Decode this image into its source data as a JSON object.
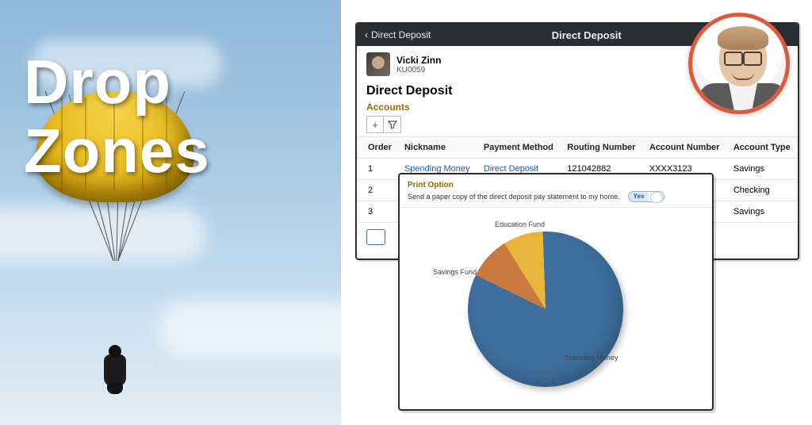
{
  "hero": {
    "title_line1": "Drop",
    "title_line2": "Zones"
  },
  "back_window": {
    "back_label": "Direct Deposit",
    "title": "Direct Deposit",
    "user": {
      "name": "Vicki Zinn",
      "id": "KU0059"
    },
    "section_heading": "Direct Deposit",
    "sub_heading": "Accounts",
    "tool_add": "+",
    "tool_filter": "⚲",
    "columns": {
      "order": "Order",
      "nickname": "Nickname",
      "payment_method": "Payment Method",
      "routing": "Routing Number",
      "account": "Account Number",
      "type": "Account Type"
    },
    "rows": [
      {
        "order": "1",
        "nickname": "Spending Money",
        "pm": "Direct Deposit",
        "routing": "121042882",
        "acct": "XXXX3123",
        "type": "Savings"
      },
      {
        "order": "2",
        "nickname": "",
        "pm": "",
        "routing": "",
        "acct": "",
        "type": "Checking"
      },
      {
        "order": "3",
        "nickname": "",
        "pm": "",
        "routing": "",
        "acct": "",
        "type": "Savings"
      }
    ]
  },
  "front_window": {
    "header": "Print Option",
    "statement": "Send a paper copy of the direct deposit pay statement to my home.",
    "toggle_label": "Yes",
    "pie_labels": {
      "education": "Education Fund",
      "savings": "Savings Fund",
      "spending": "Spending Money"
    }
  },
  "chart_data": {
    "type": "pie",
    "title": "",
    "series": [
      {
        "name": "Savings Fund",
        "value": 9,
        "color": "#c97a3f"
      },
      {
        "name": "Education Fund",
        "value": 8,
        "color": "#e8b63c"
      },
      {
        "name": "Spending Money",
        "value": 83,
        "color": "#3f6f9e"
      }
    ]
  }
}
